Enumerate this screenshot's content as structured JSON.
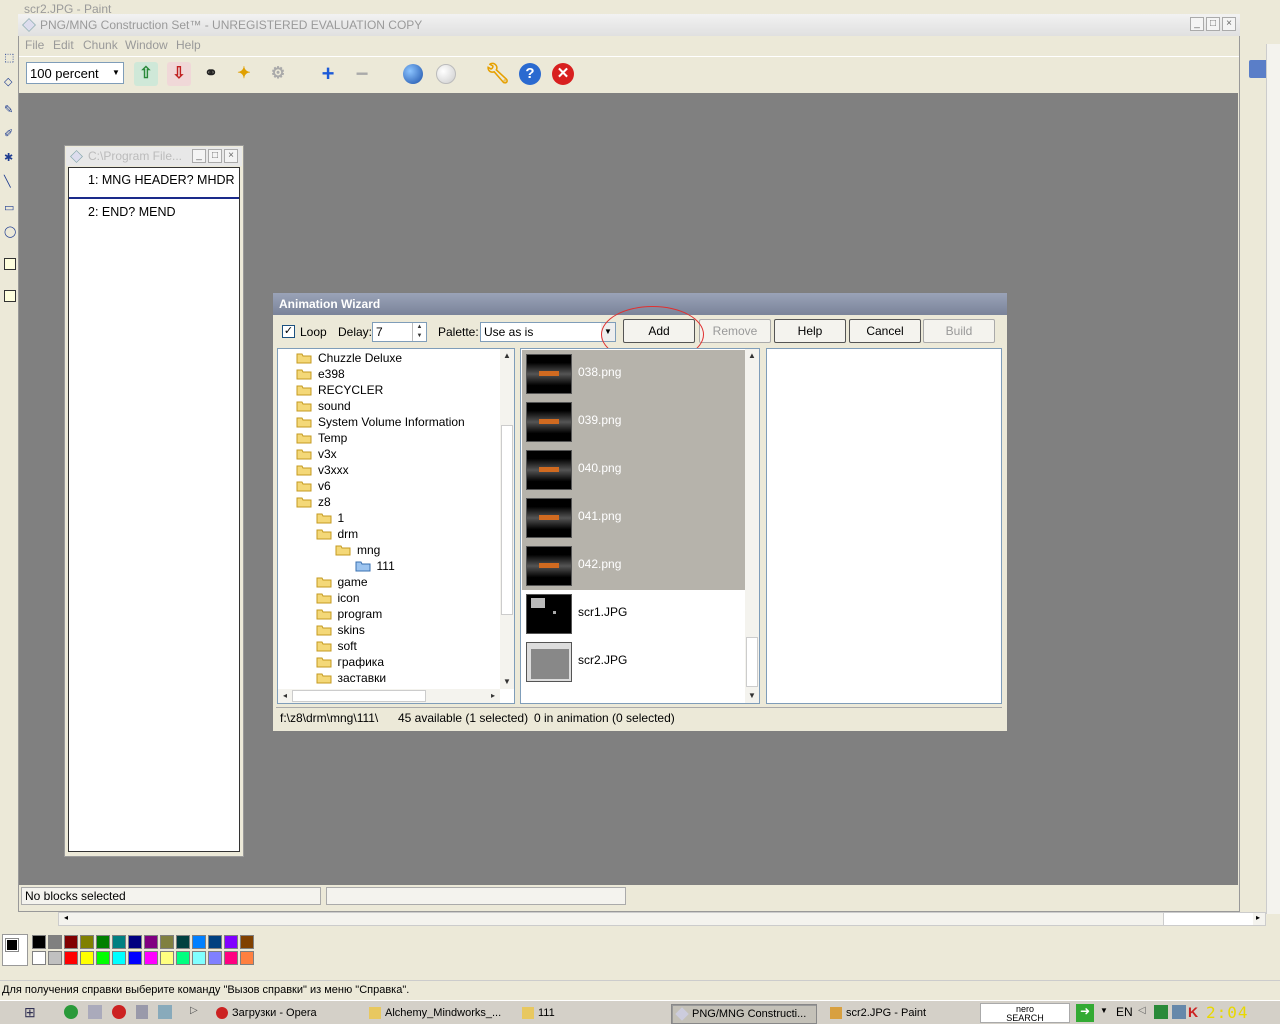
{
  "paint": {
    "title": "scr2.JPG - Paint",
    "status": "Для получения справки выберите команду \"Вызов справки\" из меню \"Справка\".",
    "palette_top": [
      "#000000",
      "#808080",
      "#800000",
      "#808000",
      "#008000",
      "#008080",
      "#000080",
      "#800080",
      "#808040",
      "#004040",
      "#0080FF",
      "#004080",
      "#8000FF",
      "#804000"
    ],
    "palette_bottom": [
      "#FFFFFF",
      "#C0C0C0",
      "#FF0000",
      "#FFFF00",
      "#00FF00",
      "#00FFFF",
      "#0000FF",
      "#FF00FF",
      "#FFFF80",
      "#00FF80",
      "#80FFFF",
      "#8080FF",
      "#FF0080",
      "#FF8040"
    ]
  },
  "main": {
    "title": "PNG/MNG Construction Set™ - UNREGISTERED EVALUATION COPY",
    "menu": [
      "File",
      "Edit",
      "Chunk",
      "Window",
      "Help"
    ],
    "zoom": "100 percent",
    "status_left": "No blocks selected",
    "status_right": ""
  },
  "child": {
    "title": "C:\\Program File...",
    "chunks": [
      "1: MNG HEADER? MHDR",
      "2: END? MEND"
    ]
  },
  "dialog": {
    "title": "Animation Wizard",
    "loop_label": "Loop",
    "delay_label": "Delay:",
    "delay_value": "7",
    "palette_label": "Palette:",
    "palette_value": "Use as is",
    "buttons": {
      "add": "Add",
      "remove": "Remove",
      "help": "Help",
      "cancel": "Cancel",
      "build": "Build"
    },
    "tree": [
      {
        "name": "Chuzzle Deluxe",
        "level": 0
      },
      {
        "name": "e398",
        "level": 0
      },
      {
        "name": "RECYCLER",
        "level": 0
      },
      {
        "name": "sound",
        "level": 0
      },
      {
        "name": "System Volume Information",
        "level": 0
      },
      {
        "name": "Temp",
        "level": 0
      },
      {
        "name": "v3x",
        "level": 0
      },
      {
        "name": "v3xxx",
        "level": 0
      },
      {
        "name": "v6",
        "level": 0
      },
      {
        "name": "z8",
        "level": 0
      },
      {
        "name": "1",
        "level": 1
      },
      {
        "name": "drm",
        "level": 1
      },
      {
        "name": "mng",
        "level": 2
      },
      {
        "name": "111",
        "level": 3
      },
      {
        "name": "game",
        "level": 1
      },
      {
        "name": "icon",
        "level": 1
      },
      {
        "name": "program",
        "level": 1
      },
      {
        "name": "skins",
        "level": 1
      },
      {
        "name": "soft",
        "level": 1
      },
      {
        "name": "графика",
        "level": 1
      },
      {
        "name": "заставки",
        "level": 1
      }
    ],
    "files": [
      {
        "name": "038.png",
        "selected": true
      },
      {
        "name": "039.png",
        "selected": true
      },
      {
        "name": "040.png",
        "selected": true
      },
      {
        "name": "041.png",
        "selected": true
      },
      {
        "name": "042.png",
        "selected": true
      },
      {
        "name": "scr1.JPG",
        "selected": false
      },
      {
        "name": "scr2.JPG",
        "selected": false
      }
    ],
    "status_path": "f:\\z8\\drm\\mng\\111\\",
    "status_available": "45 available (1 selected)",
    "status_anim": "0 in animation (0 selected)"
  },
  "taskbar": {
    "tasks": [
      {
        "label": "Загрузки - Opera",
        "active": false
      },
      {
        "label": "Alchemy_Mindworks_...",
        "active": false
      },
      {
        "label": "111",
        "active": false
      },
      {
        "label": "PNG/MNG Constructi...",
        "active": true
      },
      {
        "label": "scr2.JPG - Paint",
        "active": false
      }
    ],
    "lang": "EN",
    "clock": "2:04",
    "nero_line1": "nero",
    "nero_line2": "SEARCH"
  }
}
